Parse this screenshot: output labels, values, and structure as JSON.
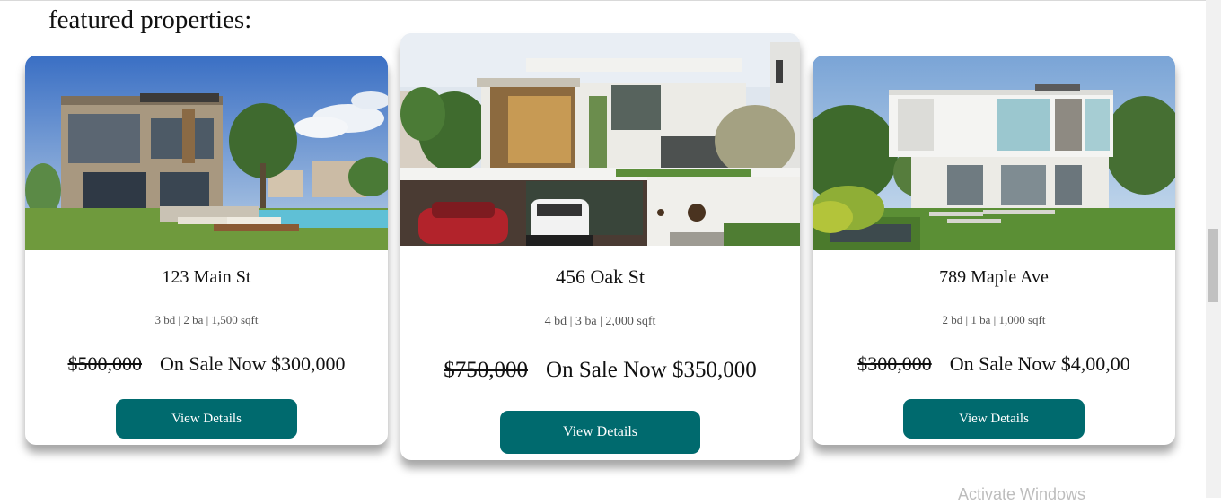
{
  "section": {
    "heading": "featured properties:"
  },
  "properties": [
    {
      "address": "123 Main St",
      "specs": "3 bd | 2 ba | 1,500 sqft",
      "original_price": "$500,000",
      "sale_label": "On Sale Now $300,000",
      "button_label": "View Details"
    },
    {
      "address": "456 Oak St",
      "specs": "4 bd | 3 ba | 2,000 sqft",
      "original_price": "$750,000",
      "sale_label": "On Sale Now $350,000",
      "button_label": "View Details"
    },
    {
      "address": "789 Maple Ave",
      "specs": "2 bd | 1 ba | 1,000 sqft",
      "original_price": "$300,000",
      "sale_label": "On Sale Now $4,00,00",
      "button_label": "View Details"
    }
  ],
  "system": {
    "watermark": "Activate Windows"
  },
  "colors": {
    "button": "#006a6e",
    "button_text": "#ffffff",
    "background": "#ffffff"
  }
}
